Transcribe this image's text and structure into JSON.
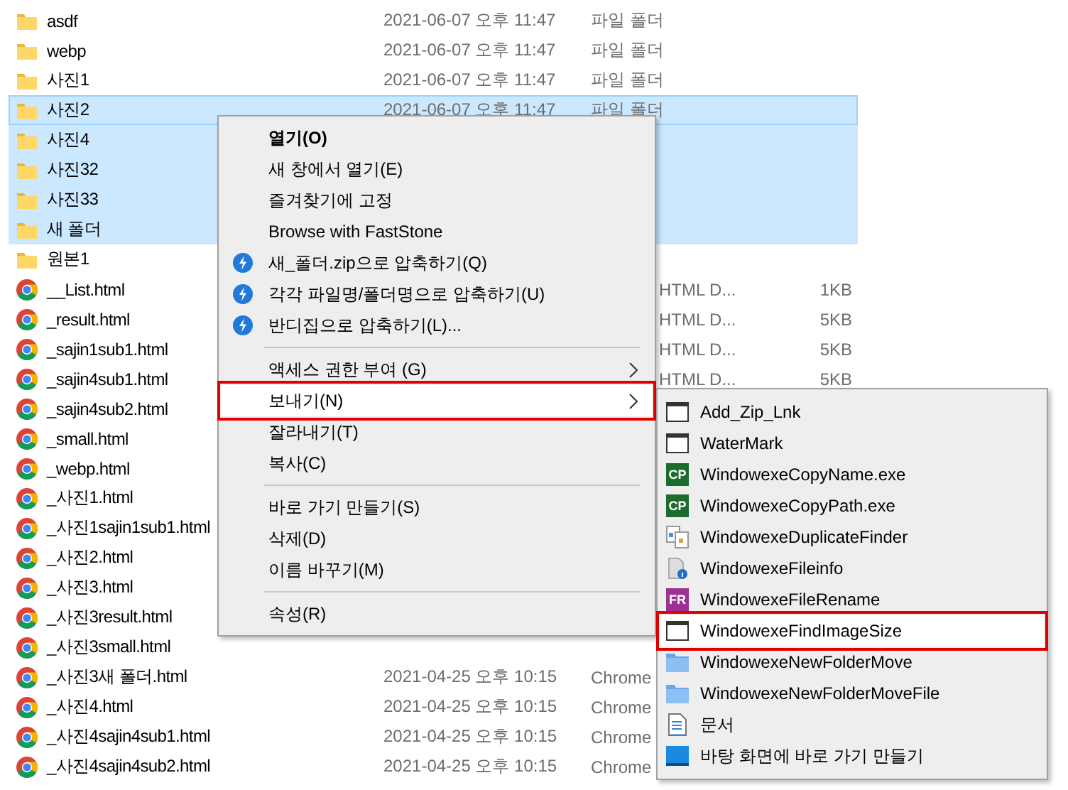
{
  "files": [
    {
      "name": "asdf",
      "kind": "folder",
      "selected": false,
      "date": "2021-06-07 오후 11:47",
      "type": "파일 폴더"
    },
    {
      "name": "webp",
      "kind": "folder",
      "selected": false,
      "date": "2021-06-07 오후 11:47",
      "type": "파일 폴더"
    },
    {
      "name": "사진1",
      "kind": "folder",
      "selected": false,
      "date": "2021-06-07 오후 11:47",
      "type": "파일 폴더"
    },
    {
      "name": "사진2",
      "kind": "folder",
      "selected": true,
      "date": "2021-06-07 오후 11:47",
      "type": "파일 폴더"
    },
    {
      "name": "사진4",
      "kind": "folder",
      "selected": true
    },
    {
      "name": "사진32",
      "kind": "folder",
      "selected": true
    },
    {
      "name": "사진33",
      "kind": "folder",
      "selected": true
    },
    {
      "name": "새 폴더",
      "kind": "folder",
      "selected": true
    },
    {
      "name": "원본1",
      "kind": "folder",
      "selected": false
    },
    {
      "name": "__List.html",
      "kind": "chrome",
      "selected": false,
      "type": "HTML D...",
      "size": "1KB"
    },
    {
      "name": "_result.html",
      "kind": "chrome",
      "selected": false,
      "type": "HTML D...",
      "size": "5KB"
    },
    {
      "name": "_sajin1sub1.html",
      "kind": "chrome",
      "selected": false,
      "type": "HTML D...",
      "size": "5KB"
    },
    {
      "name": "_sajin4sub1.html",
      "kind": "chrome",
      "selected": false,
      "type": "HTML D...",
      "size": "5KB"
    },
    {
      "name": "_sajin4sub2.html",
      "kind": "chrome",
      "selected": false
    },
    {
      "name": "_small.html",
      "kind": "chrome",
      "selected": false
    },
    {
      "name": "_webp.html",
      "kind": "chrome",
      "selected": false
    },
    {
      "name": "_사진1.html",
      "kind": "chrome",
      "selected": false
    },
    {
      "name": "_사진1sajin1sub1.html",
      "kind": "chrome",
      "selected": false
    },
    {
      "name": "_사진2.html",
      "kind": "chrome",
      "selected": false
    },
    {
      "name": "_사진3.html",
      "kind": "chrome",
      "selected": false
    },
    {
      "name": "_사진3result.html",
      "kind": "chrome",
      "selected": false
    },
    {
      "name": "_사진3small.html",
      "kind": "chrome",
      "selected": false
    },
    {
      "name": "_사진3새 폴더.html",
      "kind": "chrome",
      "selected": false,
      "date": "2021-04-25 오후 10:15",
      "type": "Chrome"
    },
    {
      "name": "_사진4.html",
      "kind": "chrome",
      "selected": false,
      "date": "2021-04-25 오후 10:15",
      "type": "Chrome"
    },
    {
      "name": "_사진4sajin4sub1.html",
      "kind": "chrome",
      "selected": false,
      "date": "2021-04-25 오후 10:15",
      "type": "Chrome"
    },
    {
      "name": "_사진4sajin4sub2.html",
      "kind": "chrome",
      "selected": false,
      "date": "2021-04-25 오후 10:15",
      "type": "Chrome"
    }
  ],
  "context_menu": [
    {
      "kind": "item",
      "label": "열기(O)",
      "bold": true,
      "highlighted": false
    },
    {
      "kind": "item",
      "label": "새 창에서 열기(E)",
      "highlighted": false
    },
    {
      "kind": "item",
      "label": "즐겨찾기에 고정",
      "highlighted": false
    },
    {
      "kind": "item",
      "label": "Browse with FastStone",
      "highlighted": false
    },
    {
      "kind": "zip",
      "label": "새_폴더.zip으로 압축하기(Q)",
      "highlighted": false
    },
    {
      "kind": "zip",
      "label": "각각 파일명/폴더명으로 압축하기(U)",
      "highlighted": false
    },
    {
      "kind": "zip",
      "label": "반디집으로 압축하기(L)...",
      "highlighted": false
    },
    {
      "kind": "separator"
    },
    {
      "kind": "item",
      "label": "액세스 권한 부여 (G)",
      "submenu": true,
      "highlighted": false
    },
    {
      "kind": "item",
      "label": "보내기(N)",
      "submenu": true,
      "highlighted": true
    },
    {
      "kind": "item",
      "label": "잘라내기(T)",
      "highlighted": false
    },
    {
      "kind": "item",
      "label": "복사(C)",
      "highlighted": false
    },
    {
      "kind": "separator"
    },
    {
      "kind": "item",
      "label": "바로 가기 만들기(S)",
      "highlighted": false
    },
    {
      "kind": "item",
      "label": "삭제(D)",
      "highlighted": false
    },
    {
      "kind": "item",
      "label": "이름 바꾸기(M)",
      "highlighted": false
    },
    {
      "kind": "separator"
    },
    {
      "kind": "item",
      "label": "속성(R)",
      "highlighted": false
    }
  ],
  "send_to_menu": [
    {
      "label": "Add_Zip_Lnk",
      "kind": "window",
      "highlighted": false
    },
    {
      "label": "WaterMark",
      "kind": "window",
      "highlighted": false
    },
    {
      "label": "WindowexeCopyName.exe",
      "kind": "badge",
      "badge": "CP",
      "color": "#1e6b2e",
      "highlighted": false
    },
    {
      "label": "WindowexeCopyPath.exe",
      "kind": "badge",
      "badge": "CP",
      "color": "#1e6b2e",
      "highlighted": false
    },
    {
      "label": "WindowexeDuplicateFinder",
      "kind": "documents",
      "highlighted": false
    },
    {
      "label": "WindowexeFileinfo",
      "kind": "fileinfo",
      "highlighted": false
    },
    {
      "label": "WindowexeFileRename",
      "kind": "badge",
      "badge": "FR",
      "color": "#9b3192",
      "highlighted": false
    },
    {
      "label": "WindowexeFindImageSize",
      "kind": "window",
      "highlighted": true
    },
    {
      "label": "WindowexeNewFolderMove",
      "kind": "folder",
      "highlighted": false
    },
    {
      "label": "WindowexeNewFolderMoveFile",
      "kind": "folder",
      "highlighted": false
    },
    {
      "label": "문서",
      "kind": "document",
      "highlighted": false
    },
    {
      "label": "바탕 화면에 바로 가기 만들기",
      "kind": "desktop",
      "highlighted": false
    }
  ]
}
